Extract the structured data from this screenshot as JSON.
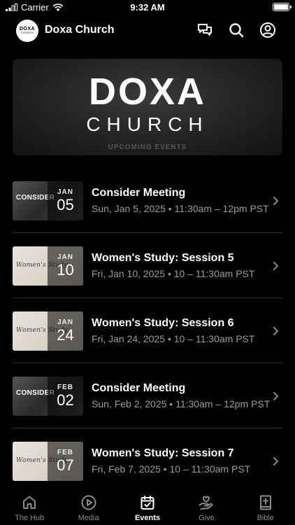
{
  "status_bar": {
    "carrier": "Carrier",
    "time": "9:32 AM",
    "battery_level": 1.0
  },
  "header": {
    "logo_line1": "DOXA",
    "logo_line2": "CHURCH",
    "title": "Doxa Church",
    "icons": [
      "chat-icon",
      "search-icon",
      "profile-icon"
    ]
  },
  "banner": {
    "word1": "DOXA",
    "word2": "CHURCH",
    "subtitle": "UPCOMING EVENTS"
  },
  "events": [
    {
      "thumb_style": "dark",
      "thumb_text": "CONSIDER",
      "month": "JAN",
      "day": "05",
      "title": "Consider Meeting",
      "subtitle": "Sun, Jan 5, 2025 • 11:30am – 12pm PST"
    },
    {
      "thumb_style": "light",
      "thumb_text": "Women's Study",
      "month": "JAN",
      "day": "10",
      "title": "Women's Study: Session 5",
      "subtitle": "Fri, Jan 10, 2025 • 10 – 11:30am PST"
    },
    {
      "thumb_style": "light",
      "thumb_text": "Women's Study",
      "month": "JAN",
      "day": "24",
      "title": "Women's Study: Session 6",
      "subtitle": "Fri, Jan 24, 2025 • 10 – 11:30am PST"
    },
    {
      "thumb_style": "dark",
      "thumb_text": "CONSIDER",
      "month": "FEB",
      "day": "02",
      "title": "Consider Meeting",
      "subtitle": "Sun, Feb 2, 2025 • 11:30am – 12pm PST"
    },
    {
      "thumb_style": "light",
      "thumb_text": "Women's Study",
      "month": "FEB",
      "day": "07",
      "title": "Women's Study: Session 7",
      "subtitle": "Fri, Feb 7, 2025 • 10 – 11:30am PST"
    }
  ],
  "tabs": [
    {
      "label": "The Hub",
      "icon": "home-icon",
      "active": false
    },
    {
      "label": "Media",
      "icon": "play-icon",
      "active": false
    },
    {
      "label": "Events",
      "icon": "calendar-icon",
      "active": true
    },
    {
      "label": "Give",
      "icon": "give-icon",
      "active": false
    },
    {
      "label": "Bible",
      "icon": "bible-icon",
      "active": false
    }
  ]
}
